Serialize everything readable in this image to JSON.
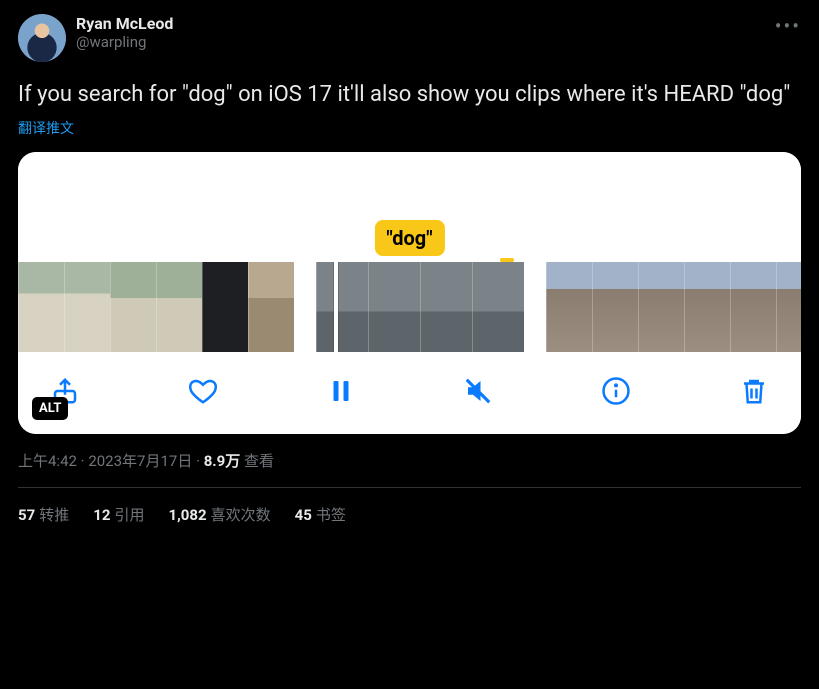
{
  "author": {
    "display_name": "Ryan McLeod",
    "handle": "@warpling"
  },
  "body": "If you search for \"dog\" on iOS 17 it'll also show you clips where it's HEARD \"dog\"",
  "translate_label": "翻译推文",
  "media": {
    "caption_label": "\"dog\"",
    "alt_badge": "ALT"
  },
  "meta": {
    "time": "上午4:42",
    "date": "2023年7月17日",
    "views_number": "8.9万",
    "views_label": "查看"
  },
  "stats": {
    "retweets_n": "57",
    "retweets_label": "转推",
    "quotes_n": "12",
    "quotes_label": "引用",
    "likes_n": "1,082",
    "likes_label": "喜欢次数",
    "bookmarks_n": "45",
    "bookmarks_label": "书签"
  }
}
